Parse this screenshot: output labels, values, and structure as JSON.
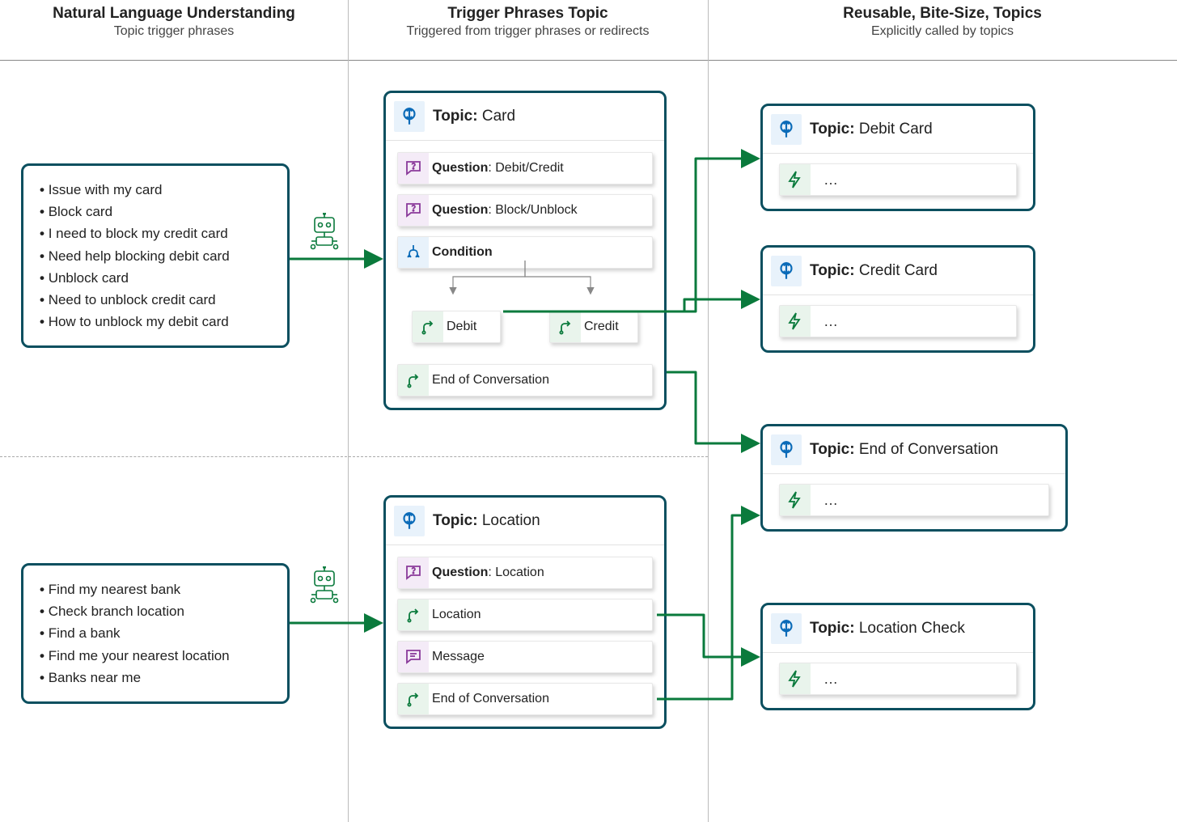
{
  "columns": [
    {
      "title": "Natural Language Understanding",
      "sub": "Topic trigger phrases"
    },
    {
      "title": "Trigger Phrases Topic",
      "sub": "Triggered from trigger phrases or redirects"
    },
    {
      "title": "Reusable, Bite-Size, Topics",
      "sub": "Explicitly called by topics"
    }
  ],
  "phrase_groups": [
    {
      "phrases": [
        "Issue with my card",
        "Block card",
        "I need to block my credit card",
        "Need help blocking debit card",
        "Unblock card",
        "Need to unblock credit card",
        "How to unblock my debit card"
      ]
    },
    {
      "phrases": [
        "Find my nearest bank",
        "Check branch location",
        "Find a bank",
        "Find me your nearest location",
        "Banks near me"
      ]
    }
  ],
  "trigger_topics": [
    {
      "title": "Card",
      "nodes": [
        {
          "type": "question",
          "label_prefix": "Question",
          "label_rest": ": Debit/Credit"
        },
        {
          "type": "question",
          "label_prefix": "Question",
          "label_rest": ": Block/Unblock"
        },
        {
          "type": "condition",
          "label_prefix": "Condition",
          "label_rest": ""
        }
      ],
      "branches": [
        {
          "label": "Debit"
        },
        {
          "label": "Credit"
        }
      ],
      "end": {
        "label": "End of Conversation"
      }
    },
    {
      "title": "Location",
      "nodes": [
        {
          "type": "question",
          "label_prefix": "Question",
          "label_rest": ": Location"
        },
        {
          "type": "redirect",
          "label_prefix": "Location",
          "label_rest": ""
        },
        {
          "type": "message",
          "label_prefix": "Message",
          "label_rest": ""
        },
        {
          "type": "redirect",
          "label_prefix": "End of Conversation",
          "label_rest": ""
        }
      ]
    }
  ],
  "reusable_topics": [
    {
      "title": "Debit Card",
      "dots": "…"
    },
    {
      "title": "Credit Card",
      "dots": "…"
    },
    {
      "title": "End of Conversation",
      "dots": "…"
    },
    {
      "title": "Location Check",
      "dots": "…"
    }
  ]
}
